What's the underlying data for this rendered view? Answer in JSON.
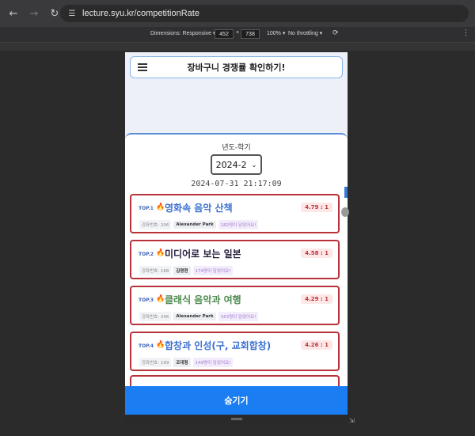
{
  "browser": {
    "url": "lecture.syu.kr/competitionRate"
  },
  "devtools": {
    "dimensions_label": "Dimensions: Responsive ▾",
    "width": "452",
    "times": "×",
    "height": "738",
    "zoom": "100% ▾",
    "throttling": "No throttling ▾"
  },
  "header": {
    "title": "장바구니 경쟁률 확인하기!"
  },
  "filter": {
    "label": "년도-학기",
    "selected": "2024-2",
    "timestamp": "2024-07-31 21:17:09"
  },
  "cards": [
    {
      "rank": "TOP.1",
      "title": "영화속 음악 산책",
      "title_color": "#3a6fcf",
      "rate": "4.79 : 1",
      "code": "강좌번호: 206",
      "professor": "Alexander Park",
      "people": "182명이 담았어요!"
    },
    {
      "rank": "TOP.2",
      "title": "미디어로 보는 일본",
      "title_color": "#2a2040",
      "rate": "4.58 : 1",
      "code": "강좌번호: 168",
      "professor": "김명현",
      "people": "174명이 담았어요!"
    },
    {
      "rank": "TOP.3",
      "title": "클래식 음악과 여행",
      "title_color": "#4e8a4f",
      "rate": "4.29 : 1",
      "code": "강좌번호: 246",
      "professor": "Alexander Park",
      "people": "163명이 담았어요!"
    },
    {
      "rank": "TOP.4",
      "title": "합창과 인성(구, 교회합창)",
      "title_color": "#3a6fcf",
      "rate": "4.26 : 1",
      "code": "강좌번호: 169",
      "professor": "조대형",
      "people": "149명이 담았어요!"
    }
  ],
  "footer": {
    "hide_label": "숨기기"
  },
  "colors": {
    "accent": "#1a7ef2",
    "card_border": "#b8323a",
    "rate_bg": "#fde7e7"
  },
  "icons": {
    "back": "arrow-left-icon",
    "forward": "arrow-right-icon",
    "reload": "reload-icon",
    "site": "site-info-icon",
    "menu": "hamburger-icon",
    "fire": "fire-icon"
  }
}
